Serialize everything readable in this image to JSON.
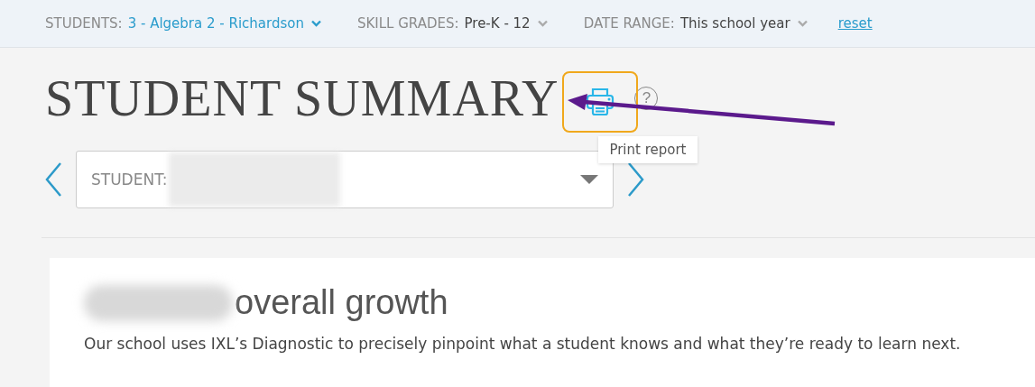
{
  "filters": [
    {
      "label": "STUDENTS:",
      "value": "3 - Algebra 2 - Richardson",
      "highlighted": true
    },
    {
      "label": "SKILL GRADES:",
      "value": "Pre-K - 12",
      "highlighted": false
    },
    {
      "label": "DATE RANGE:",
      "value": "This school year",
      "highlighted": false
    }
  ],
  "reset_link": "reset",
  "title": "STUDENT SUMMARY",
  "help_icon": "?",
  "tooltip": "Print report",
  "student_select": {
    "label": "STUDENT:"
  },
  "growth": {
    "heading": "overall growth",
    "description": "Our school uses IXL’s Diagnostic to precisely pinpoint what a student knows and what they’re ready to learn next."
  }
}
